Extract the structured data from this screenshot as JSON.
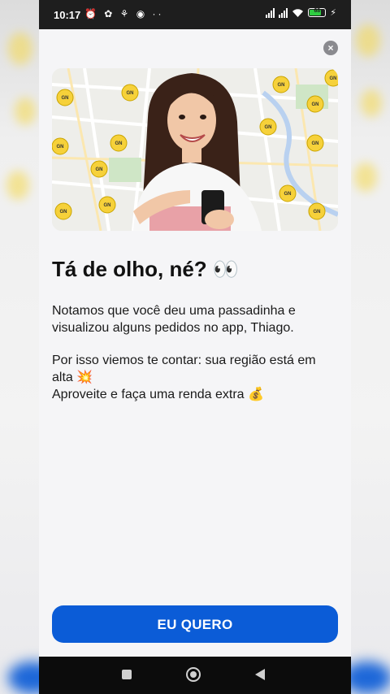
{
  "status_bar": {
    "time": "10:17",
    "left_icons": "⏰ ✿ ⚘ ◉ ··",
    "battery_level": "68"
  },
  "modal": {
    "close_icon": "×",
    "hero_pin_label": "GN",
    "headline": "Tá de olho, né? 👀",
    "paragraph1": "Notamos que você deu uma passadinha e visualizou alguns pedidos no app, Thiago.",
    "paragraph2": "Por isso viemos te contar: sua região está em alta 💥",
    "paragraph3": "Aproveite e faça uma renda extra 💰",
    "cta_label": "EU QUERO"
  },
  "colors": {
    "accent": "#0b5cd7",
    "pin": "#f6d13a"
  }
}
